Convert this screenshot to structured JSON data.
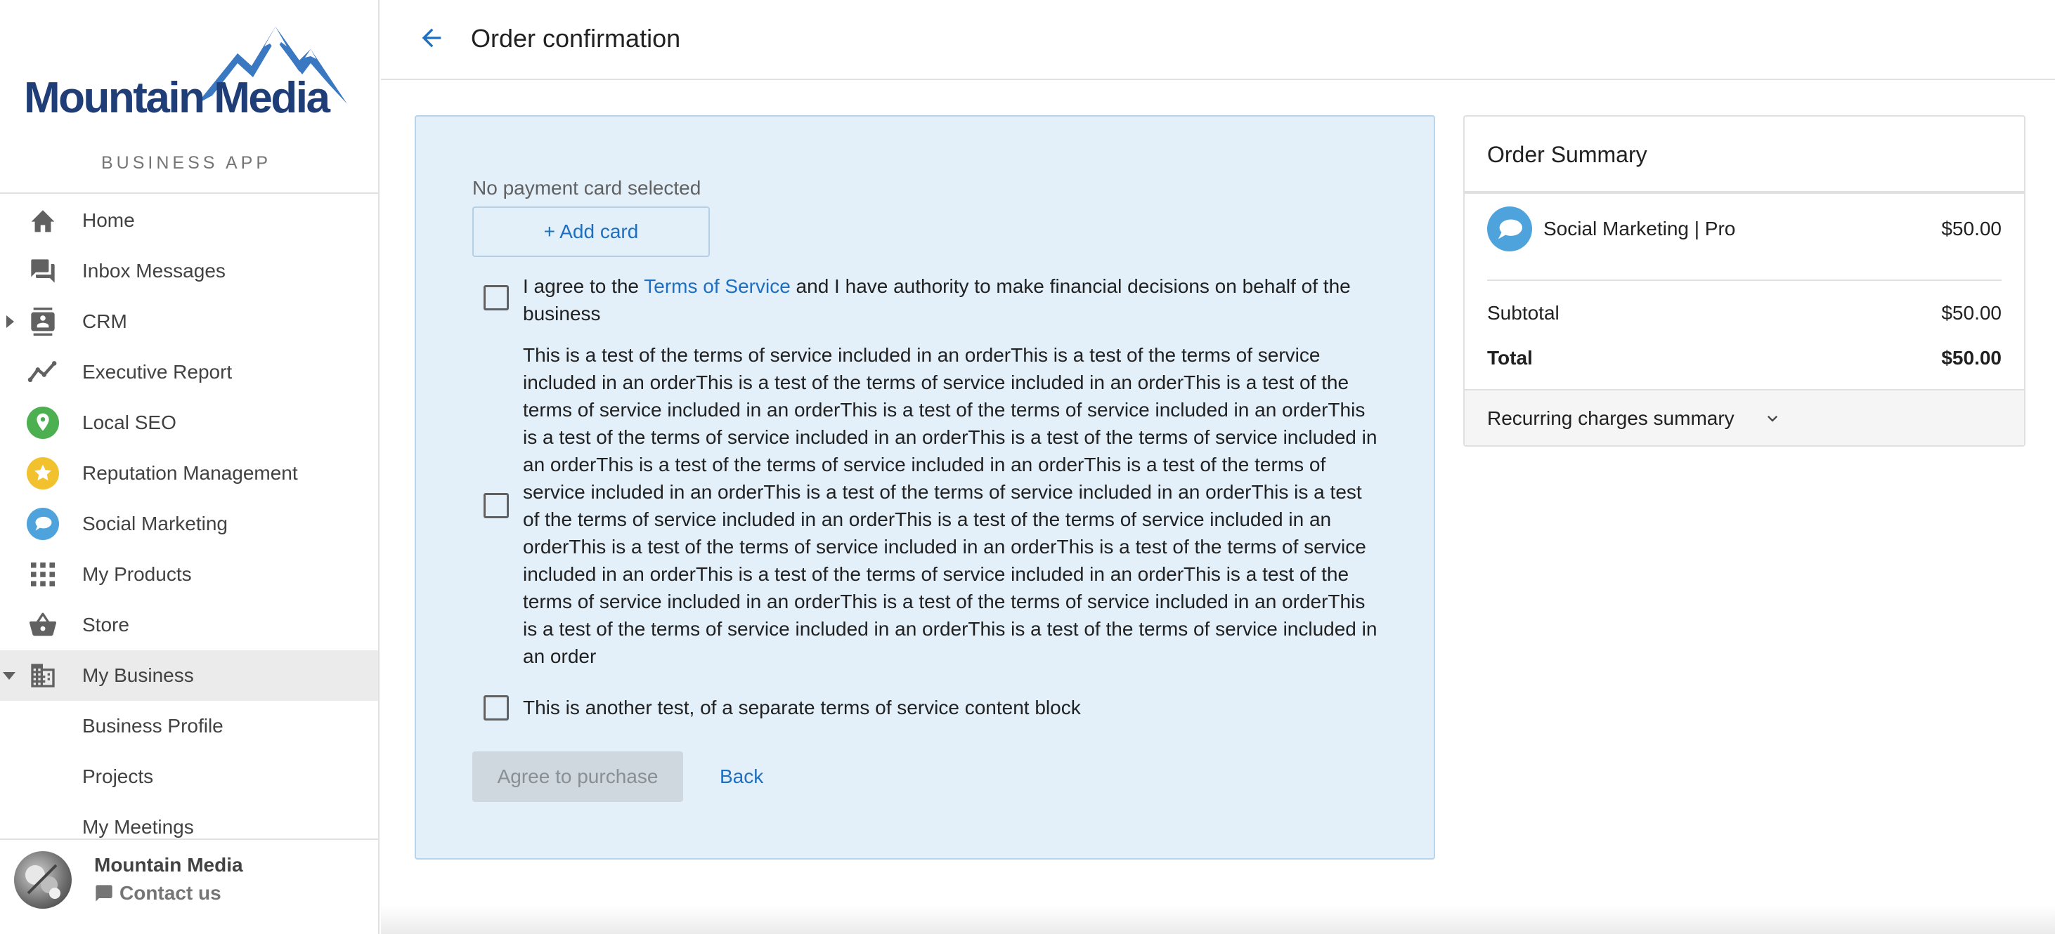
{
  "brand": {
    "name": "Mountain Media",
    "subtitle": "BUSINESS APP",
    "logo_color": "#1f3d77",
    "mountain_color": "#3b78c2"
  },
  "sidebar": {
    "items": [
      {
        "label": "Home",
        "icon": "home-icon"
      },
      {
        "label": "Inbox Messages",
        "icon": "chat-icon"
      },
      {
        "label": "CRM",
        "icon": "contacts-icon"
      },
      {
        "label": "Executive Report",
        "icon": "trend-icon"
      },
      {
        "label": "Local SEO",
        "icon": "map-pin-icon"
      },
      {
        "label": "Reputation Management",
        "icon": "star-icon"
      },
      {
        "label": "Social Marketing",
        "icon": "social-bubble-icon"
      },
      {
        "label": "My Products",
        "icon": "grid-icon"
      },
      {
        "label": "Store",
        "icon": "basket-icon"
      },
      {
        "label": "My Business",
        "icon": "building-icon"
      },
      {
        "label": "Business Profile"
      },
      {
        "label": "Projects"
      },
      {
        "label": "My Meetings"
      }
    ]
  },
  "footer": {
    "name": "Mountain Media",
    "contact": "Contact us"
  },
  "header": {
    "title": "Order confirmation"
  },
  "payment": {
    "no_card": "No payment card selected",
    "add_card": "+ Add card"
  },
  "terms": {
    "agree_prefix": "I agree to the ",
    "agree_link": "Terms of Service",
    "agree_suffix": " and I have authority to make financial decisions on behalf of the business",
    "block1": "This is a test of the terms of service included in an orderThis is a test of the terms of service included in an orderThis is a test of the terms of service included in an orderThis is a test of the terms of service included in an orderThis is a test of the terms of service included in an orderThis is a test of the terms of service included in an orderThis is a test of the terms of service included in an orderThis is a test of the terms of service included in an orderThis is a test of the terms of service included in an orderThis is a test of the terms of service included in an orderThis is a test of the terms of service included in an orderThis is a test of the terms of service included in an orderThis is a test of the terms of service included in an orderThis is a test of the terms of service included in an orderThis is a test of the terms of service included in an orderThis is a test of the terms of service included in an orderThis is a test of the terms of service included in an orderThis is a test of the terms of service included in an orderThis is a test of the terms of service included in an order",
    "block2": "This is another test, of a separate terms of service content block"
  },
  "actions": {
    "agree": "Agree to purchase",
    "back": "Back"
  },
  "summary": {
    "title": "Order Summary",
    "product": "Social Marketing | Pro",
    "product_price": "$50.00",
    "subtotal_label": "Subtotal",
    "subtotal": "$50.00",
    "total_label": "Total",
    "total": "$50.00",
    "recurring": "Recurring charges summary"
  },
  "colors": {
    "accent": "#1e6fc0",
    "panel_bg": "#e3f0fa",
    "social_icon": "#4ea3dc",
    "seo_icon": "#4caf50",
    "star_icon": "#f2c12e"
  }
}
